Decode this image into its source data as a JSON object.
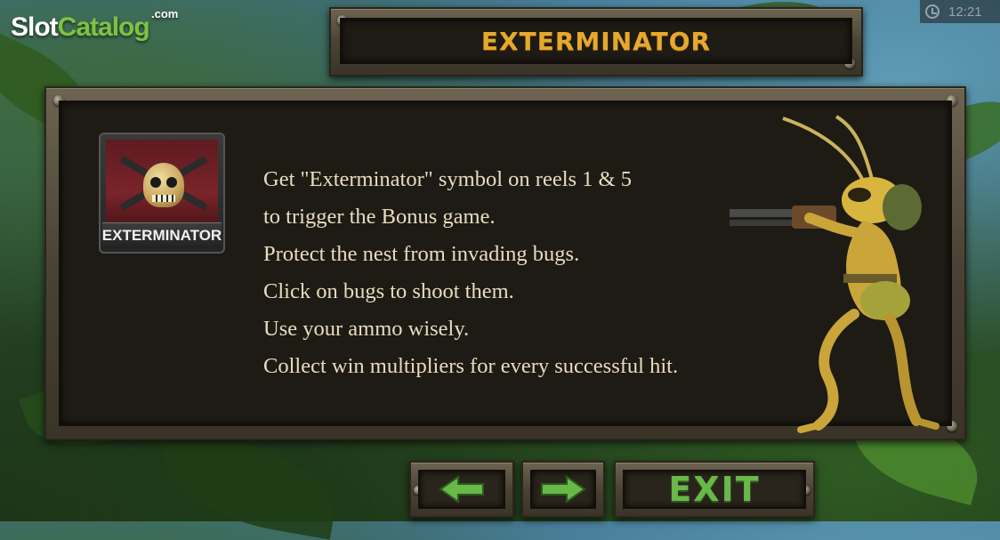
{
  "branding": {
    "part1": "Slot",
    "part2": "Catalog",
    "suffix": ".com"
  },
  "clock": {
    "time": "12:21",
    "icon": "clock-icon"
  },
  "header": {
    "title": "EXTERMINATOR"
  },
  "symbol_card": {
    "label": "EXTERMINATOR",
    "icon": "skull-crossed-guns-icon"
  },
  "description": {
    "lines": [
      "Get \"Exterminator\" symbol on reels 1 & 5",
      "to trigger the Bonus game.",
      "Protect the nest from invading bugs.",
      "Click on bugs to shoot them.",
      "Use your ammo wisely.",
      "Collect win multipliers for every successful hit."
    ]
  },
  "navigation": {
    "prev_icon": "arrow-left-icon",
    "next_icon": "arrow-right-icon",
    "exit_label": "EXIT"
  },
  "colors": {
    "title_gold": "#e6a92c",
    "text_cream": "#e8dcc0",
    "button_green": "#69b84a",
    "panel_dark": "#1e1a14"
  }
}
